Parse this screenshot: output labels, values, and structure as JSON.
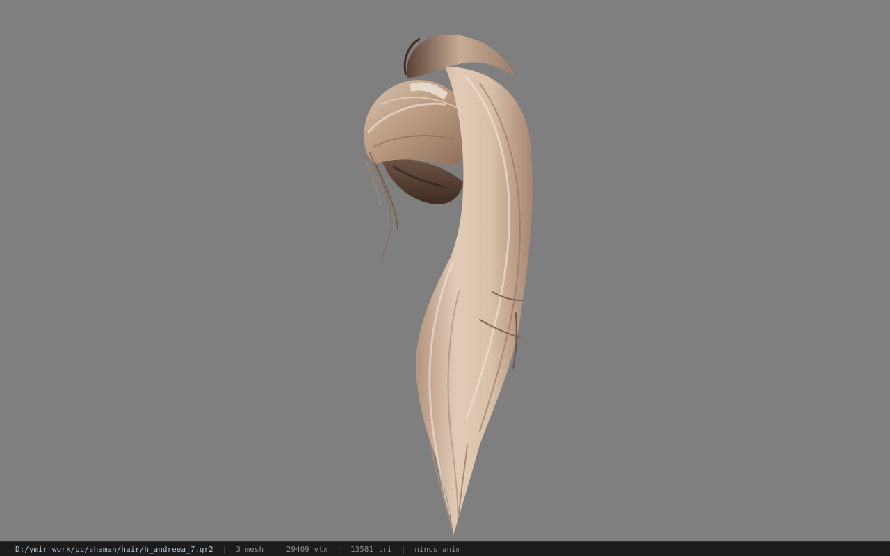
{
  "viewport": {
    "background": "#7f7f7f",
    "model_name": "h_andreea_7"
  },
  "statusbar": {
    "file_path": "D:/ymir work/pc/shaman/hair/h_andreea_7.gr2",
    "separator": "|",
    "mesh_count": "3 mesh",
    "vertex_count": "29409 vtx",
    "triangle_count": "13581 tri",
    "anim_status": "nincs anim",
    "path_color": "#a9c2d8",
    "text_color": "#8d8d8d",
    "background": "#1c1c1c"
  }
}
